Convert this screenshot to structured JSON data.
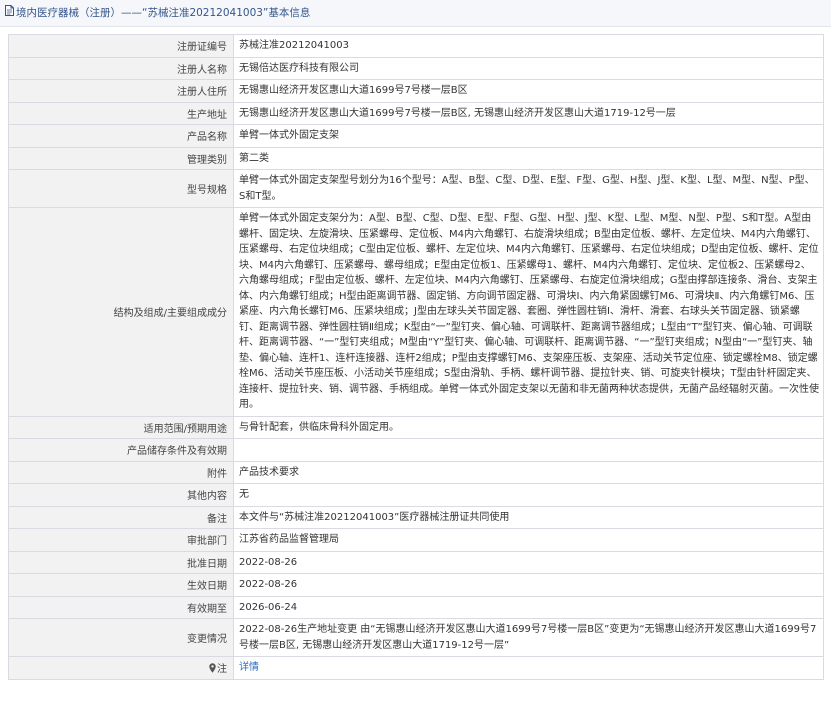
{
  "header": {
    "title": "境内医疗器械（注册）——“苏械注准20212041003”基本信息"
  },
  "rows": [
    {
      "label": "注册证编号",
      "value": "苏械注准20212041003"
    },
    {
      "label": "注册人名称",
      "value": "无锡倍达医疗科技有限公司"
    },
    {
      "label": "注册人住所",
      "value": "无锡惠山经济开发区惠山大道1699号7号楼一层B区"
    },
    {
      "label": "生产地址",
      "value": "无锡惠山经济开发区惠山大道1699号7号楼一层B区, 无锡惠山经济开发区惠山大道1719-12号一层"
    },
    {
      "label": "产品名称",
      "value": "单臂一体式外固定支架"
    },
    {
      "label": "管理类别",
      "value": "第二类"
    },
    {
      "label": "型号规格",
      "value": "单臂一体式外固定支架型号划分为16个型号：A型、B型、C型、D型、E型、F型、G型、H型、J型、K型、L型、M型、N型、P型、S和T型。"
    },
    {
      "label": "结构及组成/主要组成成分",
      "value": "单臂一体式外固定支架分为：A型、B型、C型、D型、E型、F型、G型、H型、J型、K型、L型、M型、N型、P型、S和T型。A型由螺杆、固定块、左旋滑块、压紧螺母、定位板、M4内六角螺钉、右旋滑块组成；B型由定位板、螺杆、左定位块、M4内六角螺钉、压紧螺母、右定位块组成；C型由定位板、螺杆、左定位块、M4内六角螺钉、压紧螺母、右定位块组成；D型由定位板、螺杆、定位块、M4内六角螺钉、压紧螺母、螺母组成；E型由定位板1、压紧螺母1、螺杆、M4内六角螺钉、定位块、定位板2、压紧螺母2、六角螺母组成；F型由定位板、螺杆、左定位块、M4内六角螺钉、压紧螺母、右旋定位滑块组成；G型由撑部连接条、滑台、支架主体、内六角螺钉组成；H型由距离调节器、固定销、方向调节固定器、可滑块Ⅰ、内六角紧固螺钉M6、可滑块Ⅱ、内六角螺钉M6、压紧座、内六角长螺钉M6、压紧块组成；J型由左球头关节固定器、套圈、弹性圆柱销Ⅰ、滑杆、滑套、右球头关节固定器、锁紧螺钉、距离调节器、弹性圆柱销Ⅱ组成；K型由“一”型钉夹、偏心轴、可调联杆、距离调节器组成；L型由“T”型钉夹、偏心轴、可调联杆、距离调节器、“一”型钉夹组成；M型由“Y”型钉夹、偏心轴、可调联杆、距离调节器、“一”型钉夹组成；N型由“一”型钉夹、轴垫、偏心轴、连杆1、连杆连接器、连杆2组成；P型由支撑螺钉M6、支架座压板、支架座、活动关节定位座、锁定螺栓M8、锁定螺栓M6、活动关节座压板、小活动关节座组成；S型由滑轨、手柄、螺杆调节器、提拉针夹、销、可旋夹针模块；T型由针杆固定夹、连接杆、提拉针夹、销、调节器、手柄组成。单臂一体式外固定支架以无菌和非无菌两种状态提供，无菌产品经辐射灭菌。一次性使用。"
    },
    {
      "label": "适用范围/预期用途",
      "value": "与骨针配套，供临床骨科外固定用。"
    },
    {
      "label": "产品储存条件及有效期",
      "value": ""
    },
    {
      "label": "附件",
      "value": "产品技术要求"
    },
    {
      "label": "其他内容",
      "value": "无"
    },
    {
      "label": "备注",
      "value": "本文件与“苏械注准20212041003”医疗器械注册证共同使用"
    },
    {
      "label": "审批部门",
      "value": "江苏省药品监督管理局"
    },
    {
      "label": "批准日期",
      "value": "2022-08-26"
    },
    {
      "label": "生效日期",
      "value": "2022-08-26"
    },
    {
      "label": "有效期至",
      "value": "2026-06-24"
    },
    {
      "label": "变更情况",
      "value": "2022-08-26生产地址变更 由“无锡惠山经济开发区惠山大道1699号7号楼一层B区”变更为“无锡惠山经济开发区惠山大道1699号7号楼一层B区, 无锡惠山经济开发区惠山大道1719-12号一层”"
    }
  ],
  "footer_row": {
    "label": "注",
    "link": "详情",
    "pin_icon": "location-pin-icon"
  },
  "colors": {
    "header_text": "#34558b",
    "label_bg": "#f2f2f2",
    "border": "#d8dce2",
    "link": "#2d6cc0"
  }
}
